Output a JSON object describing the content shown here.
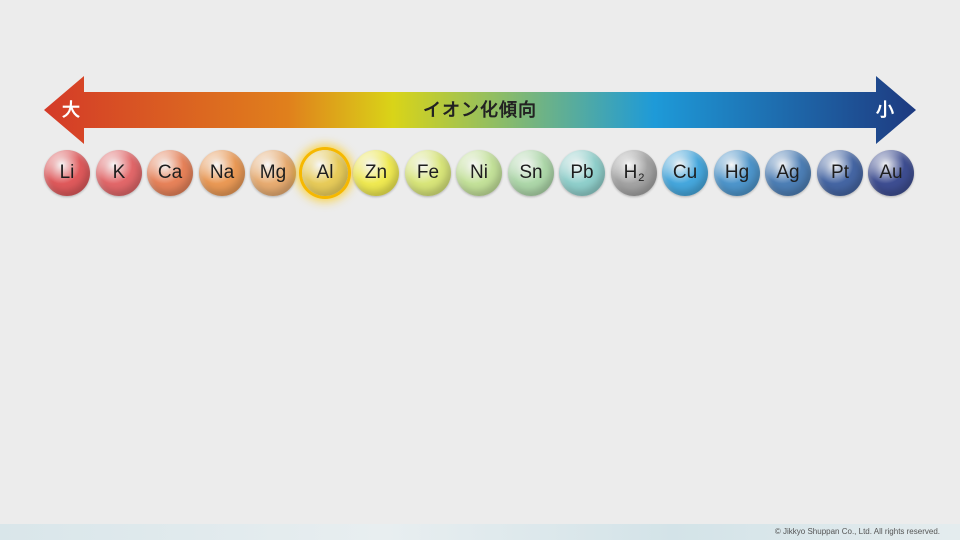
{
  "arrow": {
    "title": "イオン化傾向",
    "left_label": "大",
    "right_label": "小",
    "gradient": [
      "#d43a28",
      "#e0801c",
      "#d9d418",
      "#1e9ad8",
      "#1e3a80"
    ]
  },
  "ions": [
    {
      "symbol": "Li",
      "sub": "",
      "color": "#e05a5c",
      "highlight": false
    },
    {
      "symbol": "K",
      "sub": "",
      "color": "#e3686a",
      "highlight": false
    },
    {
      "symbol": "Ca",
      "sub": "",
      "color": "#e8835a",
      "highlight": false
    },
    {
      "symbol": "Na",
      "sub": "",
      "color": "#eb9a56",
      "highlight": false
    },
    {
      "symbol": "Mg",
      "sub": "",
      "color": "#e9ad72",
      "highlight": false
    },
    {
      "symbol": "Al",
      "sub": "",
      "color": "#e8cc5a",
      "highlight": true
    },
    {
      "symbol": "Zn",
      "sub": "",
      "color": "#f0ea52",
      "highlight": false
    },
    {
      "symbol": "Fe",
      "sub": "",
      "color": "#d9e67a",
      "highlight": false
    },
    {
      "symbol": "Ni",
      "sub": "",
      "color": "#c4e29a",
      "highlight": false
    },
    {
      "symbol": "Sn",
      "sub": "",
      "color": "#aed8aa",
      "highlight": false
    },
    {
      "symbol": "Pb",
      "sub": "",
      "color": "#90d0cc",
      "highlight": false
    },
    {
      "symbol": "H",
      "sub": "2",
      "color": "#a4a4a4",
      "highlight": false
    },
    {
      "symbol": "Cu",
      "sub": "",
      "color": "#46a8de",
      "highlight": false
    },
    {
      "symbol": "Hg",
      "sub": "",
      "color": "#4e96cc",
      "highlight": false
    },
    {
      "symbol": "Ag",
      "sub": "",
      "color": "#4d7fb6",
      "highlight": false
    },
    {
      "symbol": "Pt",
      "sub": "",
      "color": "#4566a4",
      "highlight": false
    },
    {
      "symbol": "Au",
      "sub": "",
      "color": "#3e4e92",
      "highlight": false
    }
  ],
  "copyright": "© Jikkyo Shuppan Co., Ltd. All rights reserved."
}
